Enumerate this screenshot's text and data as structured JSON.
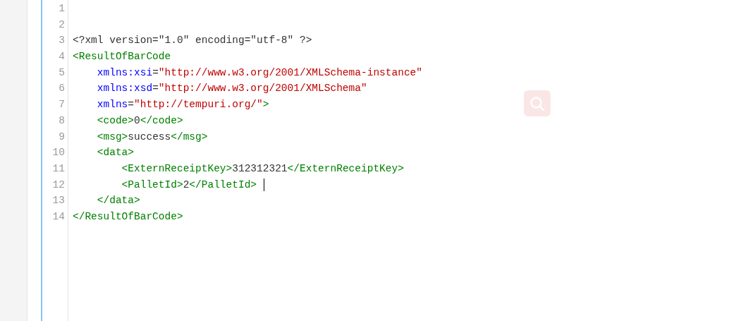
{
  "editor": {
    "lines": [
      {
        "number": "1"
      },
      {
        "number": "2"
      },
      {
        "number": "3",
        "tokens": [
          {
            "kind": "text",
            "text": "<?xml version=\"1.0\" encoding=\"utf-8\" ?>"
          }
        ]
      },
      {
        "number": "4",
        "tokens": [
          {
            "kind": "tag",
            "text": "<ResultOfBarCode"
          }
        ]
      },
      {
        "number": "5",
        "tokens": [
          {
            "kind": "attr",
            "text": "    xmlns:xsi"
          },
          {
            "kind": "text",
            "text": "="
          },
          {
            "kind": "value",
            "text": "\"http://www.w3.org/2001/XMLSchema-instance\""
          }
        ]
      },
      {
        "number": "6",
        "tokens": [
          {
            "kind": "attr",
            "text": "    xmlns:xsd"
          },
          {
            "kind": "text",
            "text": "="
          },
          {
            "kind": "value",
            "text": "\"http://www.w3.org/2001/XMLSchema\""
          }
        ]
      },
      {
        "number": "7",
        "tokens": [
          {
            "kind": "attr",
            "text": "    xmlns"
          },
          {
            "kind": "text",
            "text": "="
          },
          {
            "kind": "value",
            "text": "\"http://tempuri.org/\""
          },
          {
            "kind": "tag",
            "text": ">"
          }
        ]
      },
      {
        "number": "8",
        "tokens": [
          {
            "kind": "tag",
            "text": "    <code>"
          },
          {
            "kind": "text",
            "text": "0"
          },
          {
            "kind": "tag",
            "text": "</code>"
          }
        ]
      },
      {
        "number": "9",
        "tokens": [
          {
            "kind": "tag",
            "text": "    <msg>"
          },
          {
            "kind": "text",
            "text": "success"
          },
          {
            "kind": "tag",
            "text": "</msg>"
          }
        ]
      },
      {
        "number": "10",
        "tokens": [
          {
            "kind": "tag",
            "text": "    <data>"
          }
        ]
      },
      {
        "number": "11",
        "tokens": [
          {
            "kind": "tag",
            "text": "        <ExternReceiptKey>"
          },
          {
            "kind": "text",
            "text": "312312321"
          },
          {
            "kind": "tag",
            "text": "</ExternReceiptKey>"
          }
        ]
      },
      {
        "number": "12",
        "cursor": true,
        "tokens": [
          {
            "kind": "tag",
            "text": "        <PalletId>"
          },
          {
            "kind": "text",
            "text": "2"
          },
          {
            "kind": "tag",
            "text": "</PalletId>"
          }
        ]
      },
      {
        "number": "13",
        "tokens": [
          {
            "kind": "tag",
            "text": "    </data>"
          }
        ]
      },
      {
        "number": "14",
        "tokens": [
          {
            "kind": "tag",
            "text": "</ResultOfBarCode>"
          }
        ]
      }
    ]
  }
}
